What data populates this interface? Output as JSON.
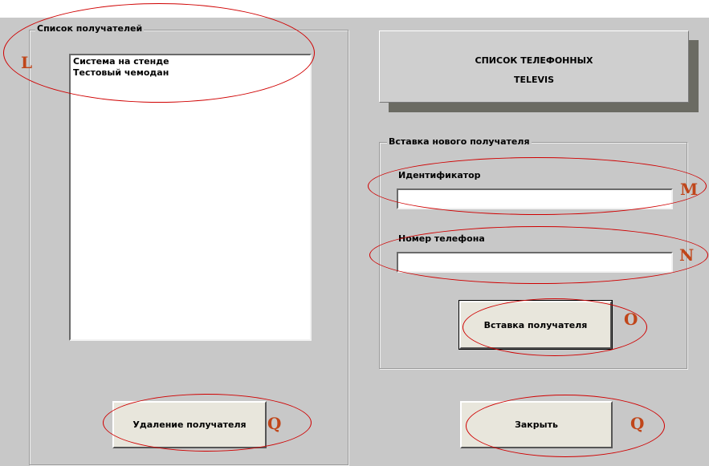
{
  "recipients_group": {
    "legend": "Список получателей",
    "items": [
      "Система на стенде",
      "Тестовый чемодан"
    ],
    "delete_button": "Удаление получателя"
  },
  "title_box": {
    "line1": "СПИСОК ТЕЛЕФОННЫХ",
    "line2": "TELEVIS"
  },
  "insert_group": {
    "legend": "Вставка нового получателя",
    "id_label": "Идентификатор",
    "id_value": "",
    "phone_label": "Номер телефона",
    "phone_value": "",
    "insert_button": "Вставка получателя"
  },
  "close_button": "Закрыть",
  "markers": {
    "L": "L",
    "M": "M",
    "N": "N",
    "O": "O",
    "Q_left": "Q",
    "Q_right": "Q"
  },
  "colors": {
    "annotation_ellipse": "#d00000",
    "annotation_letter": "#c0461a",
    "panel_bg": "#c8c8c8"
  }
}
